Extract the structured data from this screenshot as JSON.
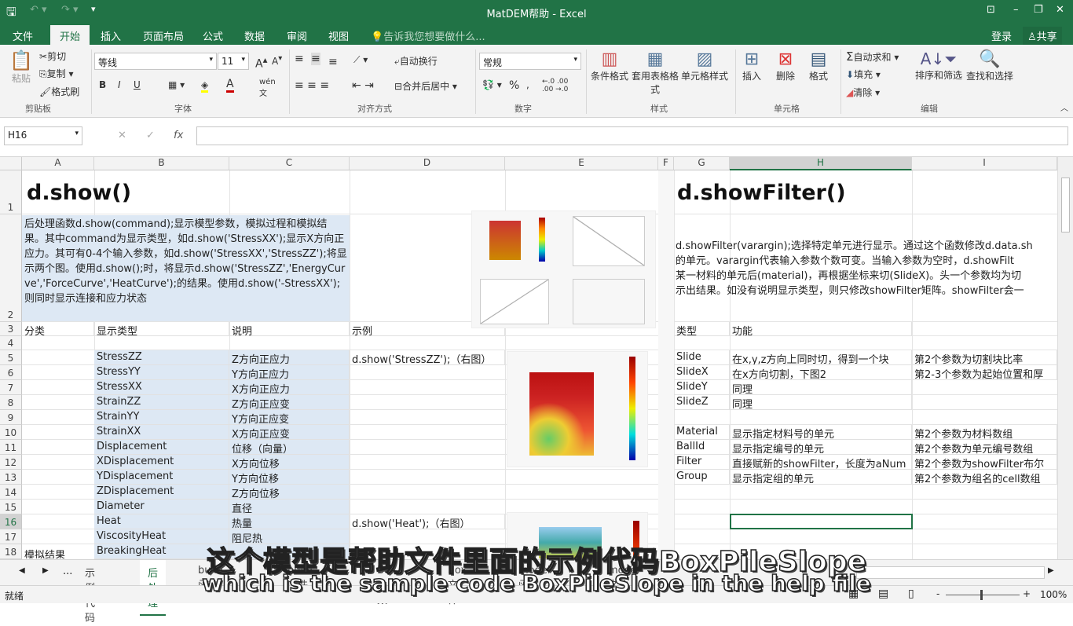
{
  "window": {
    "title": "MatDEM帮助 - Excel",
    "controls": [
      "⊡",
      "–",
      "❐",
      "✕"
    ]
  },
  "ribbon_tabs": [
    "文件",
    "开始",
    "插入",
    "页面布局",
    "公式",
    "数据",
    "审阅",
    "视图"
  ],
  "tell_me": "告诉我您想要做什么...",
  "login": "登录",
  "share": "共享",
  "clipboard": {
    "paste": "粘贴",
    "cut": "剪切",
    "copy": "复制",
    "format_painter": "格式刷",
    "group": "剪贴板"
  },
  "font": {
    "name": "等线",
    "size": "11",
    "group": "字体",
    "bold": "B",
    "italic": "I",
    "underline": "U"
  },
  "alignment": {
    "wrap": "自动换行",
    "merge": "合并后居中",
    "group": "对齐方式"
  },
  "number": {
    "format": "常规",
    "percent": "%",
    "group": "数字"
  },
  "styles": {
    "conditional": "条件格式",
    "table": "套用表格格式",
    "cell": "单元格样式",
    "group": "样式"
  },
  "cells": {
    "insert": "插入",
    "delete": "删除",
    "format": "格式",
    "group": "单元格"
  },
  "editing": {
    "autosum": "自动求和",
    "fill": "填充",
    "clear": "清除",
    "sort": "排序和筛选",
    "find": "查找和选择",
    "group": "编辑"
  },
  "formula_bar": {
    "name_box": "H16",
    "fx": "fx",
    "value": ""
  },
  "columns": [
    "A",
    "B",
    "C",
    "D",
    "E",
    "F",
    "G",
    "H",
    "I"
  ],
  "rows": [
    "1",
    "2",
    "3",
    "4",
    "5",
    "6",
    "7",
    "8",
    "9",
    "10",
    "11",
    "12",
    "13",
    "14",
    "15",
    "16",
    "17",
    "18"
  ],
  "left": {
    "title": "d.show()",
    "desc": "后处理函数d.show(command);显示模型参数，模拟过程和模拟结果。其中command为显示类型，如d.show('StressXX');显示X方向正应力。其可有0-4个输入参数，如d.show('StressXX','StressZZ');将显示两个图。使用d.show();时，将显示d.show('StressZZ','EnergyCurve','ForceCurve','HeatCurve');的结果。使用d.show('-StressXX');则同时显示连接和应力状态",
    "headers": [
      "分类",
      "显示类型",
      "说明",
      "示例"
    ],
    "items": [
      {
        "type": "StressZZ",
        "desc": "Z方向正应力",
        "example": "d.show('StressZZ');（右图）"
      },
      {
        "type": "StressYY",
        "desc": "Y方向正应力",
        "example": ""
      },
      {
        "type": "StressXX",
        "desc": "X方向正应力",
        "example": ""
      },
      {
        "type": "StrainZZ",
        "desc": "Z方向正应变",
        "example": ""
      },
      {
        "type": "StrainYY",
        "desc": "Y方向正应变",
        "example": ""
      },
      {
        "type": "StrainXX",
        "desc": "X方向正应变",
        "example": ""
      },
      {
        "type": "Displacement",
        "desc": "位移（向量）",
        "example": ""
      },
      {
        "type": "XDisplacement",
        "desc": "X方向位移",
        "example": ""
      },
      {
        "type": "YDisplacement",
        "desc": "Y方向位移",
        "example": ""
      },
      {
        "type": "ZDisplacement",
        "desc": "Z方向位移",
        "example": ""
      },
      {
        "type": "Diameter",
        "desc": "直径",
        "example": ""
      },
      {
        "type": "Heat",
        "desc": "热量",
        "example": "d.show('Heat');（右图）"
      },
      {
        "type": "ViscosityHeat",
        "desc": "阻尼热",
        "example": ""
      },
      {
        "type": "BreakingHeat",
        "desc": "",
        "example": ""
      }
    ],
    "category_a18": "模拟结果"
  },
  "right": {
    "title": "d.showFilter()",
    "desc_lines": [
      "d.showFilter(varargin);选择特定单元进行显示。通过这个函数修改d.data.sh",
      "的单元。varargin代表输入参数个数可变。当输入参数为空时，d.showFilt",
      "某一材料的单元后(material)，再根据坐标来切(SlideX)。头一个参数均为切",
      "示出结果。如没有说明显示类型，则只修改showFilter矩阵。showFilter会一"
    ],
    "headers": [
      "类型",
      "功能"
    ],
    "items": [
      {
        "row": 5,
        "type": "Slide",
        "func": "在x,y,z方向上同时切，得到一个块",
        "note": "第2个参数为切割块比率"
      },
      {
        "row": 6,
        "type": "SlideX",
        "func": "在x方向切割，下图2",
        "note": "第2-3个参数为起始位置和厚"
      },
      {
        "row": 7,
        "type": "SlideY",
        "func": "同理",
        "note": ""
      },
      {
        "row": 8,
        "type": "SlideZ",
        "func": "同理",
        "note": ""
      },
      {
        "row": 10,
        "type": "Material",
        "func": "显示指定材料号的单元",
        "note": "第2个参数为材料数组"
      },
      {
        "row": 11,
        "type": "BallId",
        "func": "显示指定编号的单元",
        "note": "第2个参数为单元编号数组"
      },
      {
        "row": 12,
        "type": "Filter",
        "func": "直接赋新的showFilter，长度为aNum",
        "note": "第2个参数为showFilter布尔"
      },
      {
        "row": 13,
        "type": "Group",
        "func": "显示指定组的单元",
        "note": "第2个参数为组名的cell数组"
      }
    ]
  },
  "sheet_tabs": [
    "示例代码",
    "后处理",
    "build函数",
    "build文件",
    "Box函数",
    "Box文件",
    "model函数",
    "model文件"
  ],
  "active_sheet": "后处理",
  "status": {
    "ready": "就绪",
    "zoom": "100%"
  },
  "subtitles": {
    "zh": "这个模型是帮助文件里面的示例代码BoxPileSlope",
    "en": "which is the sample code BoxPileSlope in the help file"
  },
  "colors": {
    "accent": "#217346",
    "selection": "#217346",
    "cell_fill": "#dde8f4"
  }
}
